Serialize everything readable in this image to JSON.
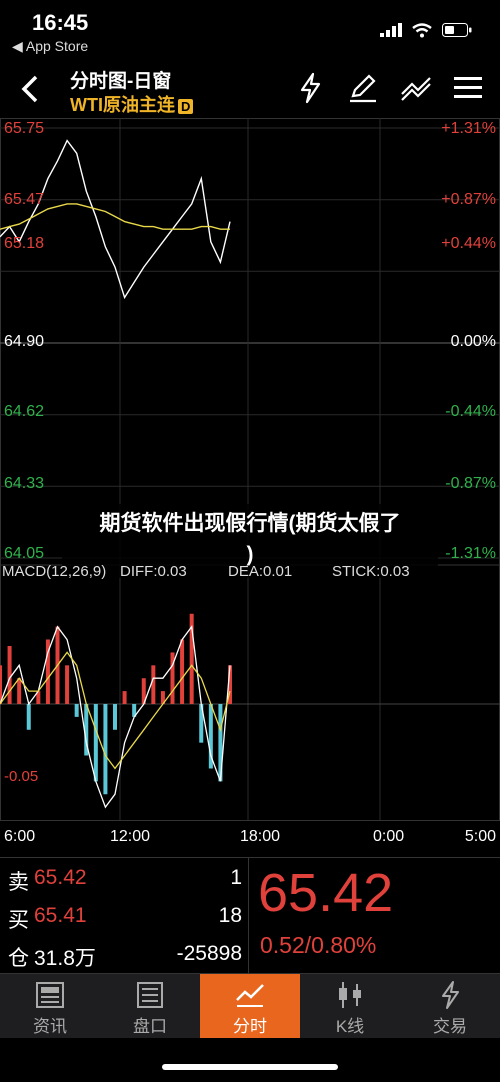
{
  "status_bar": {
    "time": "16:45",
    "back_app": "◀ App Store"
  },
  "header": {
    "title": "分时图-日窗",
    "subtitle": "WTI原油主连",
    "subtitle_badge": "D",
    "icons": [
      "flash-icon",
      "pen-icon",
      "trend-icon",
      "menu-icon"
    ]
  },
  "price_axis": {
    "left": [
      "65.75",
      "65.47",
      "65.18",
      "64.90",
      "64.62",
      "64.33",
      "64.05"
    ],
    "right": [
      "+1.31%",
      "+0.87%",
      "+0.44%",
      "0.00%",
      "-0.44%",
      "-0.87%",
      "-1.31%"
    ]
  },
  "overlay_text": {
    "line1": "期货软件出现假行情(期货太假了",
    "line2": ")"
  },
  "macd": {
    "label": "MACD(12,26,9)",
    "diff": "DIFF:0.03",
    "dea": "DEA:0.01",
    "stick": "STICK:0.03",
    "level_low": "-0.05"
  },
  "time_axis": [
    "6:00",
    "12:00",
    "18:00",
    "0:00",
    "5:00"
  ],
  "quote": {
    "sell": {
      "label": "卖",
      "price": "65.42",
      "qty": "1"
    },
    "buy": {
      "label": "买",
      "price": "65.41",
      "qty": "18"
    },
    "oi": {
      "label": "仓",
      "value": "31.8万",
      "change": "-25898"
    },
    "last": "65.42",
    "change": "0.52/0.80%"
  },
  "tabs": [
    {
      "label": "资讯",
      "icon": "news-icon"
    },
    {
      "label": "盘口",
      "icon": "orderbook-icon"
    },
    {
      "label": "分时",
      "icon": "timeshare-icon",
      "active": true
    },
    {
      "label": "K线",
      "icon": "candlestick-icon"
    },
    {
      "label": "交易",
      "icon": "trade-icon"
    }
  ],
  "colors": {
    "up": "#e0413b",
    "down": "#2fb24c",
    "accent": "#e8661e",
    "avg_line": "#e8d84a",
    "macd_neg": "#5bc8d8"
  },
  "chart_data": {
    "type": "line",
    "x": [
      "6:00",
      "12:00",
      "18:00",
      "0:00",
      "5:00"
    ],
    "y_range": [
      64.05,
      65.75
    ],
    "prev_close": 64.9,
    "series": [
      {
        "values": [
          65.32,
          65.36,
          65.3,
          65.38,
          65.45,
          65.55,
          65.62,
          65.7,
          65.65,
          65.5,
          65.4,
          65.28,
          65.2,
          65.08,
          65.14,
          65.2,
          65.25,
          65.3,
          65.35,
          65.4,
          65.45,
          65.55,
          65.3,
          65.22,
          65.38
        ]
      },
      {
        "values": [
          65.35,
          65.36,
          65.37,
          65.39,
          65.41,
          65.43,
          65.44,
          65.45,
          65.45,
          65.44,
          65.43,
          65.42,
          65.4,
          65.38,
          65.37,
          65.36,
          65.36,
          65.35,
          65.35,
          65.35,
          65.35,
          65.36,
          65.36,
          65.35,
          65.35
        ]
      }
    ],
    "macd_bars": [
      0.03,
      0.045,
      0.02,
      -0.02,
      0.01,
      0.05,
      0.06,
      0.03,
      -0.01,
      -0.04,
      -0.06,
      -0.07,
      -0.02,
      0.01,
      -0.01,
      0.02,
      0.03,
      0.01,
      0.04,
      0.05,
      0.07,
      -0.03,
      -0.05,
      -0.06,
      0.03
    ],
    "macd_diff": [
      0.0,
      0.02,
      0.03,
      0.0,
      0.01,
      0.04,
      0.06,
      0.05,
      0.02,
      -0.03,
      -0.06,
      -0.08,
      -0.07,
      -0.03,
      -0.01,
      0.0,
      0.02,
      0.02,
      0.03,
      0.05,
      0.06,
      0.0,
      -0.04,
      -0.06,
      0.03
    ],
    "macd_dea": [
      0.0,
      0.01,
      0.02,
      0.01,
      0.01,
      0.02,
      0.03,
      0.04,
      0.03,
      0.0,
      -0.02,
      -0.04,
      -0.05,
      -0.04,
      -0.03,
      -0.02,
      -0.01,
      0.0,
      0.01,
      0.02,
      0.03,
      0.02,
      0.0,
      -0.02,
      0.01
    ],
    "macd_range": [
      -0.09,
      0.09
    ]
  }
}
